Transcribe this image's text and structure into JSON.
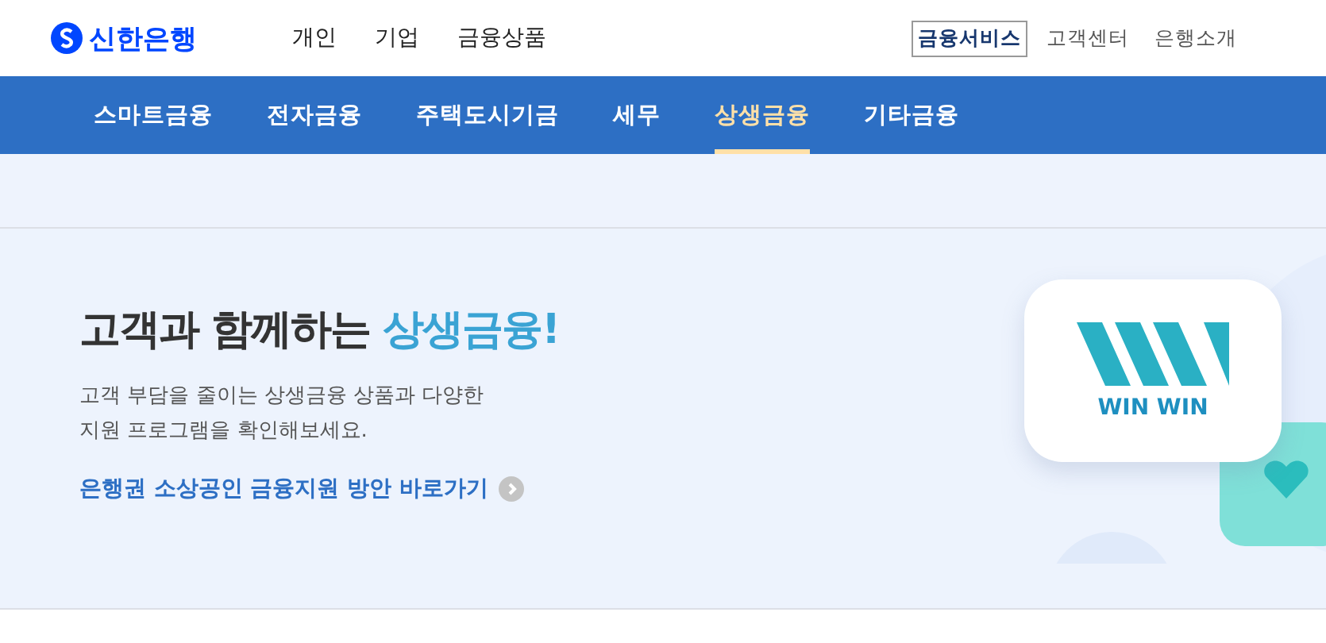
{
  "header": {
    "logo": "신한은행",
    "main_menu": [
      {
        "label": "개인"
      },
      {
        "label": "기업"
      },
      {
        "label": "금융상품"
      }
    ],
    "util_menu": [
      {
        "label": "금융서비스",
        "selected": true
      },
      {
        "label": "고객센터",
        "selected": false
      },
      {
        "label": "은행소개",
        "selected": false
      }
    ]
  },
  "nav": {
    "tabs": [
      {
        "label": "스마트금융",
        "selected": false
      },
      {
        "label": "전자금융",
        "selected": false
      },
      {
        "label": "주택도시기금",
        "selected": false
      },
      {
        "label": "세무",
        "selected": false
      },
      {
        "label": "상생금융",
        "selected": true
      },
      {
        "label": "기타금융",
        "selected": false
      }
    ]
  },
  "hero": {
    "title": "고객과 함께하는",
    "title_highlight": "상생금융!",
    "description": [
      "고객 부담을 줄이는 상생금융 상품과 다양한",
      "지원 프로그램을 확인해보세요."
    ],
    "link": "은행권 소상공인 금융지원 방안 바로가기",
    "badge": "WIN WIN"
  }
}
